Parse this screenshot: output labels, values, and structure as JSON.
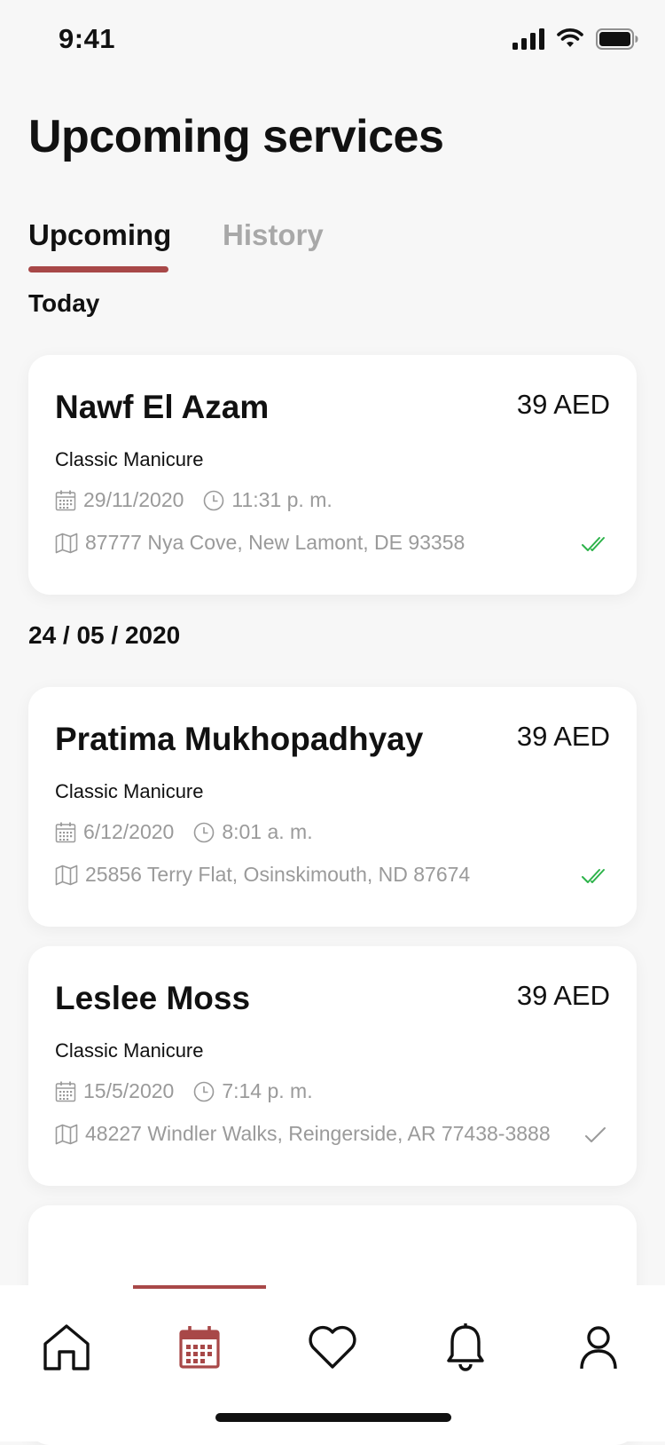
{
  "status_bar": {
    "time": "9:41"
  },
  "page": {
    "title": "Upcoming services"
  },
  "tabs": [
    {
      "label": "Upcoming",
      "active": true
    },
    {
      "label": "History",
      "active": false
    }
  ],
  "sections": [
    {
      "label": "Today"
    },
    {
      "label": "24 / 05 / 2020"
    }
  ],
  "appointments": [
    {
      "name": "Nawf El Azam",
      "price": "39 AED",
      "service": "Classic Manicure",
      "date": "29/11/2020",
      "time": "11:31 p. m.",
      "address": "87777 Nya Cove, New Lamont, DE 93358",
      "status": "double-check-icon"
    },
    {
      "name": "Pratima Mukhopadhyay",
      "price": "39 AED",
      "service": "Classic Manicure",
      "date": "6/12/2020",
      "time": "8:01 a. m.",
      "address": "25856 Terry Flat, Osinskimouth, ND 87674",
      "status": "double-check-icon"
    },
    {
      "name": "Leslee Moss",
      "price": "39 AED",
      "service": "Classic Manicure",
      "date": "15/5/2020",
      "time": "7:14 p. m.",
      "address": "48227 Windler Walks, Reingerside, AR 77438-3888",
      "status": "single-check-icon"
    }
  ],
  "bottom_nav": {
    "items": [
      "home-icon",
      "calendar-icon",
      "heart-icon",
      "bell-icon",
      "user-icon"
    ],
    "active_index": 1
  },
  "colors": {
    "accent": "#a84848",
    "confirmed_green": "#2db34a",
    "muted_grey": "#9a9a9a",
    "background": "#f7f7f7"
  }
}
